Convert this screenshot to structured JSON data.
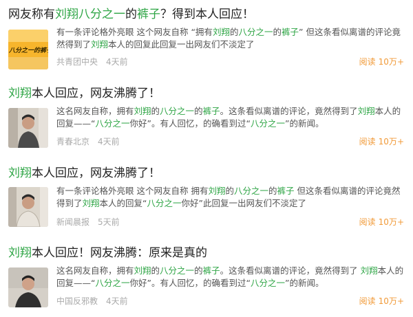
{
  "accent_color": "#2ea545",
  "read_color": "#f19a38",
  "articles": [
    {
      "title_parts": [
        {
          "text": "网友称有",
          "hl": false
        },
        {
          "text": "刘翔",
          "hl": true
        },
        {
          "text": "八分之一",
          "hl": true
        },
        {
          "text": "的",
          "hl": false
        },
        {
          "text": "裤子",
          "hl": true
        },
        {
          "text": "？得到本人回应！",
          "hl": false
        }
      ],
      "thumb_icon": "banner-image",
      "thumb_text": "八分之一的裤子",
      "summary_parts": [
        {
          "text": "有一条评论格外亮眼 这个网友自称 “拥有",
          "hl": false
        },
        {
          "text": "刘翔",
          "hl": true
        },
        {
          "text": "的",
          "hl": false
        },
        {
          "text": "八分之一",
          "hl": true
        },
        {
          "text": "的",
          "hl": false
        },
        {
          "text": "裤子",
          "hl": true
        },
        {
          "text": "” 但这条看似离谱的评论竟然得到了",
          "hl": false
        },
        {
          "text": "刘翔",
          "hl": true
        },
        {
          "text": "本人的回复此回复一出网友们不淡定了",
          "hl": false
        }
      ],
      "source": "共青团中央",
      "time": "4天前",
      "read_label": "阅读",
      "read_count": "10万+"
    },
    {
      "title_parts": [
        {
          "text": "刘翔",
          "hl": true
        },
        {
          "text": "本人回应，网友沸腾了！",
          "hl": false
        }
      ],
      "thumb_icon": "person-photo",
      "summary_parts": [
        {
          "text": "这名网友自称，拥有",
          "hl": false
        },
        {
          "text": "刘翔",
          "hl": true
        },
        {
          "text": "的",
          "hl": false
        },
        {
          "text": "八分之一",
          "hl": true
        },
        {
          "text": "的",
          "hl": false
        },
        {
          "text": "裤子",
          "hl": true
        },
        {
          "text": "。这条看似离谱的评论，竟然得到了",
          "hl": false
        },
        {
          "text": "刘翔",
          "hl": true
        },
        {
          "text": "本人的回复——“",
          "hl": false
        },
        {
          "text": "八分之一",
          "hl": true
        },
        {
          "text": "你好”。有人回忆，的确看到过“",
          "hl": false
        },
        {
          "text": "八分之一",
          "hl": true
        },
        {
          "text": "”的新闻。",
          "hl": false
        }
      ],
      "source": "青春北京",
      "time": "4天前",
      "read_label": "阅读",
      "read_count": "10万+"
    },
    {
      "title_parts": [
        {
          "text": "刘翔",
          "hl": true
        },
        {
          "text": "本人回应，网友沸腾了！",
          "hl": false
        }
      ],
      "thumb_icon": "person-photo",
      "summary_parts": [
        {
          "text": "有一条评论格外亮眼 这个网友自称 拥有",
          "hl": false
        },
        {
          "text": "刘翔",
          "hl": true
        },
        {
          "text": "的",
          "hl": false
        },
        {
          "text": "八分之一",
          "hl": true
        },
        {
          "text": "的",
          "hl": false
        },
        {
          "text": "裤子",
          "hl": true
        },
        {
          "text": " 但这条看似离谱的评论竟然得到了",
          "hl": false
        },
        {
          "text": "刘翔",
          "hl": true
        },
        {
          "text": "本人的回复“",
          "hl": false
        },
        {
          "text": "八分之一",
          "hl": true
        },
        {
          "text": "你好”此回复一出网友们不淡定了",
          "hl": false
        }
      ],
      "source": "新闻晨报",
      "time": "5天前",
      "read_label": "阅读",
      "read_count": "10万+"
    },
    {
      "title_parts": [
        {
          "text": "刘翔",
          "hl": true
        },
        {
          "text": "本人回应！网友沸腾：原来是真的",
          "hl": false
        }
      ],
      "thumb_icon": "person-photo",
      "summary_parts": [
        {
          "text": "这名网友自称，拥有",
          "hl": false
        },
        {
          "text": "刘翔",
          "hl": true
        },
        {
          "text": "的",
          "hl": false
        },
        {
          "text": "八分之一",
          "hl": true
        },
        {
          "text": "的",
          "hl": false
        },
        {
          "text": "裤子",
          "hl": true
        },
        {
          "text": "。这条看似离谱的评论，竟然得到了 ",
          "hl": false
        },
        {
          "text": "刘翔",
          "hl": true
        },
        {
          "text": "本人的回复——“",
          "hl": false
        },
        {
          "text": "八分之一",
          "hl": true
        },
        {
          "text": "你好”。有人回忆，的确看到过“",
          "hl": false
        },
        {
          "text": "八分之一",
          "hl": true
        },
        {
          "text": "”的新闻。",
          "hl": false
        }
      ],
      "source": "中国反邪教",
      "time": "4天前",
      "read_label": "阅读",
      "read_count": "10万+"
    }
  ]
}
